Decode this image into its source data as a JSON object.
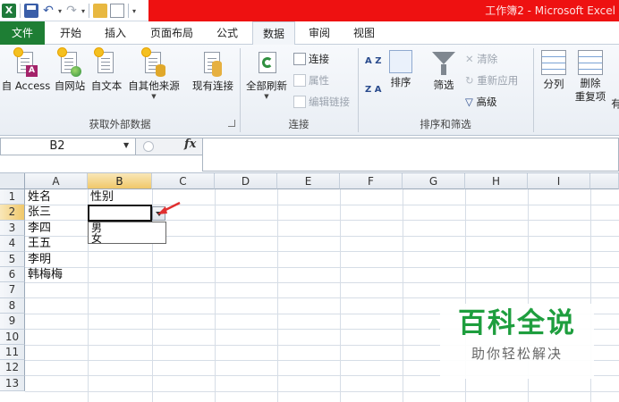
{
  "window": {
    "title": "工作簿2 - Microsoft Excel",
    "title_bar_color": "#ee1111",
    "qat_icons": [
      "excel-logo-icon",
      "save-icon",
      "undo-icon",
      "redo-icon",
      "open-folder-icon",
      "new-document-icon",
      "customize-qat-icon"
    ],
    "excel_logo_letter": "X"
  },
  "ribbon": {
    "tabs": [
      {
        "label": "文件",
        "active": false
      },
      {
        "label": "开始",
        "active": false
      },
      {
        "label": "插入",
        "active": false
      },
      {
        "label": "页面布局",
        "active": false
      },
      {
        "label": "公式",
        "active": false
      },
      {
        "label": "数据",
        "active": true
      },
      {
        "label": "审阅",
        "active": false
      },
      {
        "label": "视图",
        "active": false
      }
    ],
    "file_tab_color": "#1e7e34",
    "groups": {
      "external": {
        "label": "获取外部数据",
        "buttons": [
          "自 Access",
          "自网站",
          "自文本",
          "自其他来源",
          "现有连接"
        ]
      },
      "connections": {
        "label": "连接",
        "refresh_all": "全部刷新",
        "connections": "连接",
        "properties": "属性",
        "edit_links": "编辑链接"
      },
      "sort_filter": {
        "label": "排序和筛选",
        "sort_az": "A Z",
        "sort_za": "Z A",
        "sort": "排序",
        "filter": "筛选",
        "clear": "清除",
        "reapply": "重新应用",
        "advanced": "高级"
      },
      "tools": {
        "text_to_columns": "分列",
        "remove_duplicates_line1": "删除",
        "remove_duplicates_line2": "重复项",
        "cut_off": "有"
      }
    }
  },
  "formula_bar": {
    "name_box": "B2",
    "fx_label": "fx",
    "formula": ""
  },
  "sheet": {
    "columns": [
      "A",
      "B",
      "C",
      "D",
      "E",
      "F",
      "G",
      "H",
      "I"
    ],
    "selected_column": "B",
    "rows": [
      "1",
      "2",
      "3",
      "4",
      "5",
      "6",
      "7",
      "8",
      "9",
      "10",
      "11",
      "12",
      "13"
    ],
    "selected_row": "2",
    "cells": {
      "A1": "姓名",
      "B1": "性别",
      "A2": "张三",
      "A3": "李四",
      "A4": "王五",
      "A5": "李明",
      "A6": "韩梅梅"
    },
    "active_cell": "B2",
    "dropdown_options": [
      "男",
      "女"
    ],
    "annotation_arrow_color": "#e03030"
  },
  "watermark": {
    "main": "百科全说",
    "sub": "助你轻松解决",
    "color": "#1e9e3e"
  }
}
